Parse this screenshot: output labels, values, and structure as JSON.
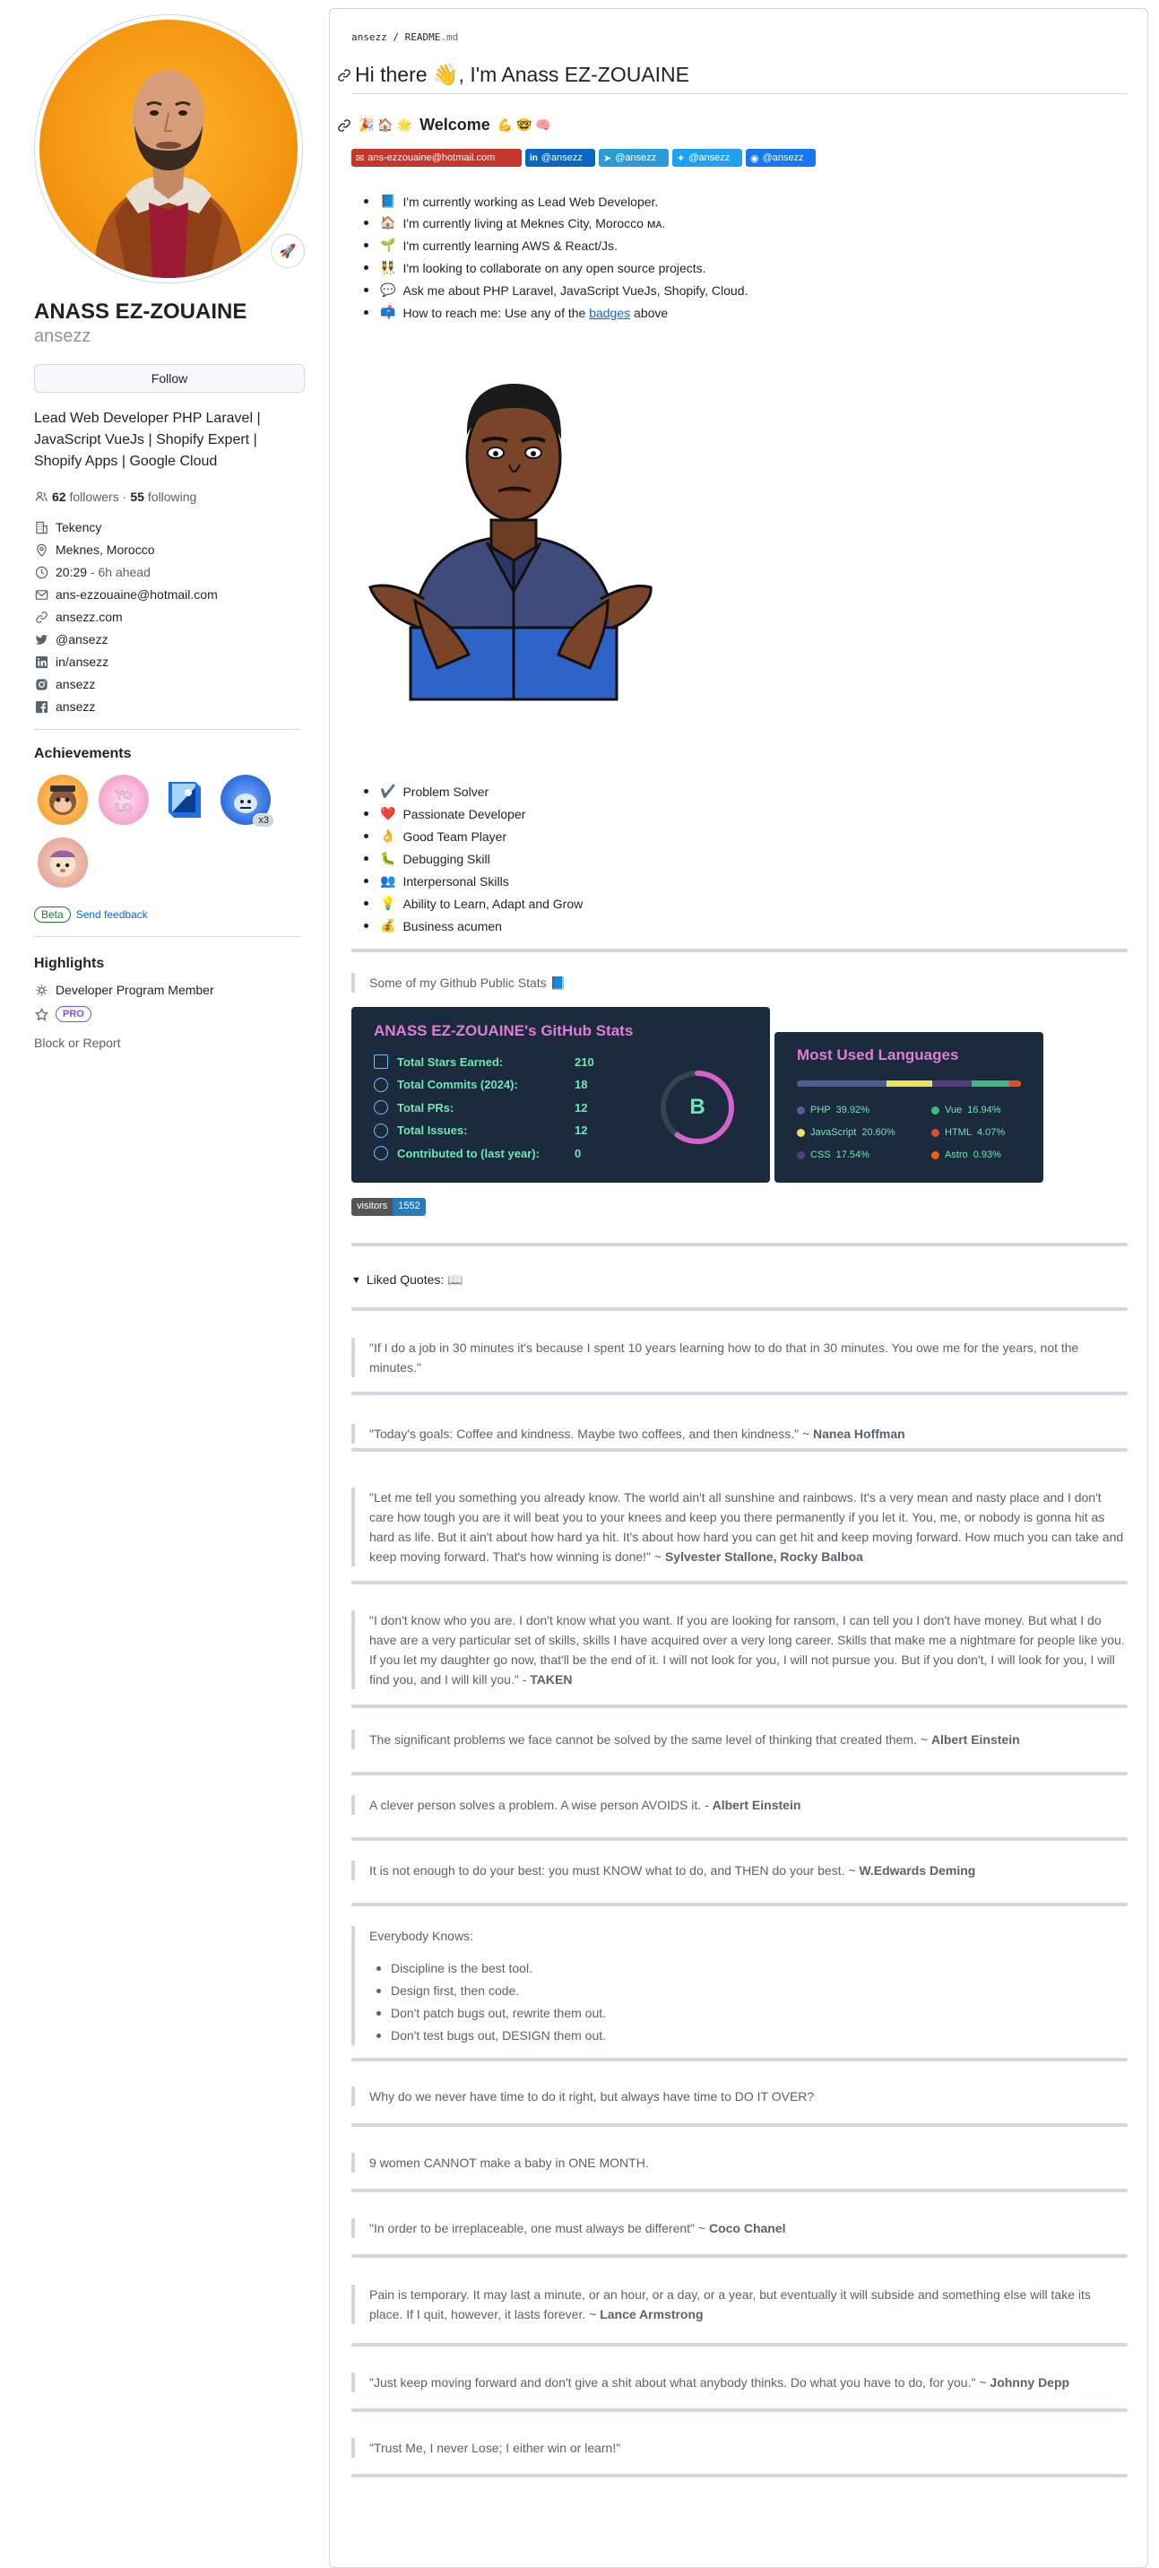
{
  "profile": {
    "fullname": "ANASS EZ-ZOUAINE",
    "login": "ansezz",
    "follow_label": "Follow",
    "bio": "Lead Web Developer PHP Laravel | JavaScript VueJs | Shopify Expert | Shopify Apps | Google Cloud",
    "followers_count": "62",
    "followers_label": "followers",
    "separator": "·",
    "following_count": "55",
    "following_label": "following",
    "details": [
      {
        "icon": "organization-icon",
        "text": "Tekency"
      },
      {
        "icon": "location-icon",
        "text": "Meknes, Morocco"
      },
      {
        "icon": "clock-icon",
        "text": "20:29",
        "extra": " - 6h ahead"
      },
      {
        "icon": "mail-icon",
        "text": "ans-ezzouaine@hotmail.com"
      },
      {
        "icon": "link-icon",
        "text": "ansezz.com"
      },
      {
        "icon": "twitter-icon",
        "text": "@ansezz"
      },
      {
        "icon": "linkedin-icon",
        "text": "in/ansezz"
      },
      {
        "icon": "instagram-icon",
        "text": "ansezz"
      },
      {
        "icon": "facebook-icon",
        "text": "ansezz"
      }
    ],
    "achievements_title": "Achievements",
    "achievement_badge_multiplier": "x3",
    "beta_label": "Beta",
    "feedback_label": "Send feedback",
    "highlights_title": "Highlights",
    "highlight_member": "Developer Program Member",
    "pro_label": "PRO",
    "block_report": "Block or Report"
  },
  "readme": {
    "breadcrumb_user": "ansezz",
    "breadcrumb_sep": " / ",
    "breadcrumb_file": "README",
    "breadcrumb_ext": ".md",
    "title": "Hi there 👋, I'm Anass EZ-ZOUAINE",
    "welcome_prefix": "🎉 🏠 🌟",
    "welcome": "Welcome",
    "welcome_suffix": "💪 🤓 🧠",
    "shields": [
      {
        "label": "ans-ezzouaine@hotmail.com",
        "color": "#c5372c",
        "icon": "gmail-icon"
      },
      {
        "label": "@ansezz",
        "color": "#0a66c2",
        "icon": "linkedin-icon"
      },
      {
        "label": "@ansezz",
        "color": "#2b9bd6",
        "icon": "telegram-icon"
      },
      {
        "label": "@ansezz",
        "color": "#1da1f2",
        "icon": "twitter-icon"
      },
      {
        "label": "@ansezz",
        "color": "#1877f2",
        "icon": "messenger-icon"
      }
    ],
    "about": [
      {
        "emoji": "📘",
        "text": "I'm currently working as Lead Web Developer."
      },
      {
        "emoji": "🏠",
        "text": "I'm currently living at Meknes City, Morocco ᴍᴀ."
      },
      {
        "emoji": "🌱",
        "text": "I'm currently learning AWS & React/Js."
      },
      {
        "emoji": "👯",
        "text": "I'm looking to collaborate on any open source projects."
      },
      {
        "emoji": "💬",
        "text": "Ask me about PHP Laravel, JavaScript VueJs, Shopify, Cloud."
      },
      {
        "emoji": "📫",
        "text": "How to reach me: Use any of the",
        "link": "badges",
        "after": " above"
      }
    ],
    "skills": [
      {
        "emoji": "✔️",
        "text": "Problem Solver"
      },
      {
        "emoji": "❤️",
        "text": "Passionate Developer"
      },
      {
        "emoji": "👌",
        "text": "Good Team Player"
      },
      {
        "emoji": "🐛",
        "text": "Debugging Skill"
      },
      {
        "emoji": "👥",
        "text": "Interpersonal Skills"
      },
      {
        "emoji": "💡",
        "text": "Ability to Learn, Adapt and Grow"
      },
      {
        "emoji": "💰",
        "text": "Business acumen"
      }
    ],
    "stats_intro": "Some of my Github Public Stats 📘",
    "stats_card": {
      "title": "ANASS EZ-ZOUAINE's GitHub Stats",
      "rows": [
        {
          "label": "Total Stars Earned:",
          "value": "210",
          "icon": "star-icon"
        },
        {
          "label": "Total Commits (2024):",
          "value": "18",
          "icon": "history-icon"
        },
        {
          "label": "Total PRs:",
          "value": "12",
          "icon": "pull-request-icon"
        },
        {
          "label": "Total Issues:",
          "value": "12",
          "icon": "issue-icon"
        },
        {
          "label": "Contributed to (last year):",
          "value": "0",
          "icon": "repo-icon"
        }
      ],
      "rank": "B",
      "rank_progress": 0.6
    },
    "langs_card": {
      "title": "Most Used Languages",
      "langs": [
        {
          "name": "PHP",
          "pct": "39.92%",
          "value": 39.92,
          "color": "#4F5D95"
        },
        {
          "name": "Vue",
          "pct": "16.94%",
          "value": 16.94,
          "color": "#41b883"
        },
        {
          "name": "JavaScript",
          "pct": "20.60%",
          "value": 20.6,
          "color": "#f1e05a"
        },
        {
          "name": "HTML",
          "pct": "4.07%",
          "value": 4.07,
          "color": "#e34c26"
        },
        {
          "name": "CSS",
          "pct": "17.54%",
          "value": 17.54,
          "color": "#563d7c"
        },
        {
          "name": "Astro",
          "pct": "0.93%",
          "value": 0.93,
          "color": "#ff5a03"
        }
      ]
    },
    "visitors_label": "visitors",
    "visitors_count": "1552",
    "details_summary": "Liked Quotes: 📖",
    "quotes": [
      {
        "text": "\"If I do a job in 30 minutes it's because I spent 10 years learning how to do that in 30 minutes. You owe me for the years, not the minutes.\"",
        "author": ""
      },
      {
        "text": "\"Today's goals: Coffee and kindness. Maybe two coffees, and then kindness.\" ~ ",
        "author": "Nanea Hoffman"
      },
      {
        "text": "\"Let me tell you something you already know. The world ain't all sunshine and rainbows. It's a very mean and nasty place and I don't care how tough you are it will beat you to your knees and keep you there permanently if you let it. You, me, or nobody is gonna hit as hard as life. But it ain't about how hard ya hit. It's about how hard you can get hit and keep moving forward. How much you can take and keep moving forward. That's how winning is done!\" ~ ",
        "author": "Sylvester Stallone, Rocky Balboa"
      },
      {
        "text": "\"I don't know who you are. I don't know what you want. If you are looking for ransom, I can tell you I don't have money. But what I do have are a very particular set of skills, skills I have acquired over a very long career. Skills that make me a nightmare for people like you. If you let my daughter go now, that'll be the end of it. I will not look for you, I will not pursue you. But if you don't, I will look for you, I will find you, and I will kill you.\" - ",
        "author": "TAKEN"
      },
      {
        "text": "The significant problems we face cannot be solved by the same level of thinking that created them. ~ ",
        "author": "Albert Einstein"
      },
      {
        "text": "A clever person solves a problem. A wise person AVOIDS it. - ",
        "author": "Albert Einstein"
      },
      {
        "text": "It is not enough to do your best: you must KNOW what to do, and THEN do your best. ~ ",
        "author": "W.Edwards Deming"
      }
    ],
    "everybody_title": "Everybody Knows:",
    "everybody": [
      "Discipline is the best tool.",
      "Design first, then code.",
      "Don't patch bugs out, rewrite them out.",
      "Don't test bugs out, DESIGN them out."
    ],
    "quotes2": [
      {
        "text": "Why do we never have time to do it right, but always have time to DO IT OVER?",
        "author": ""
      },
      {
        "text": "9 women CANNOT make a baby in ONE MONTH.",
        "author": ""
      },
      {
        "text": "\"In order to be irreplaceable, one must always be different\" ~ ",
        "author": "Coco Chanel"
      },
      {
        "text": "Pain is temporary. It may last a minute, or an hour, or a day, or a year, but eventually it will subside and something else will take its place. If I quit, however, it lasts forever. ~ ",
        "author": "Lance Armstrong"
      },
      {
        "text": "\"Just keep moving forward and don't give a shit about what anybody thinks. Do what you have to do, for you.\" ~ ",
        "author": "Johnny Depp"
      },
      {
        "text": "\"Trust Me, I never Lose; I either win or learn!\"",
        "author": ""
      }
    ]
  }
}
